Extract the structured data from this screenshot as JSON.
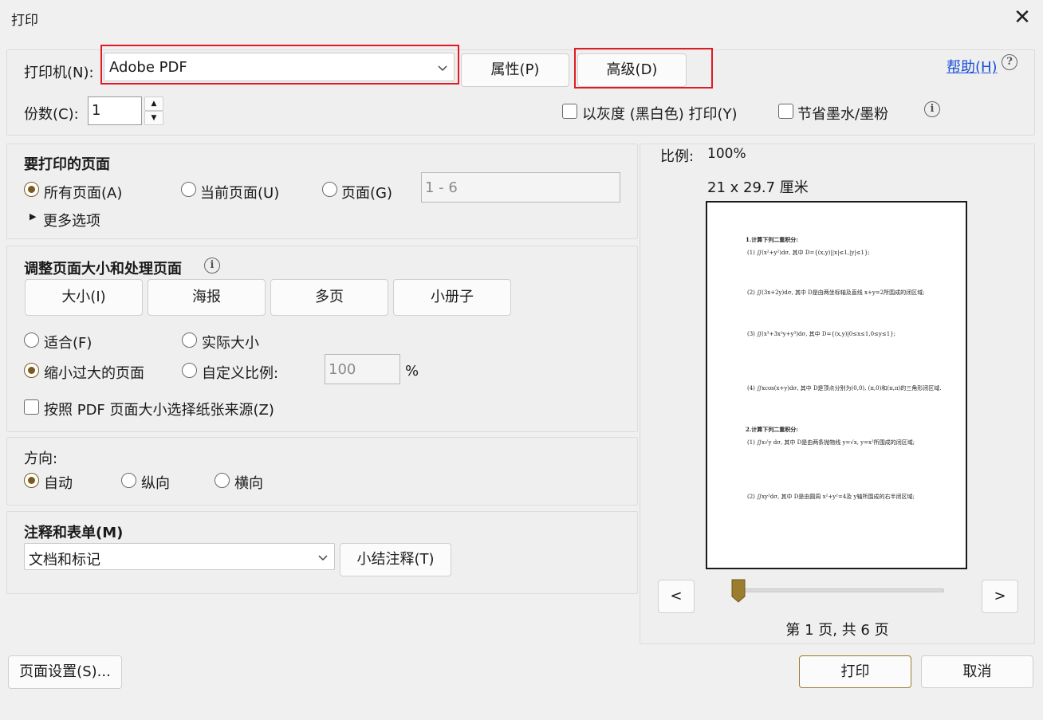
{
  "window": {
    "title": "打印",
    "close_icon": "close-icon"
  },
  "printer": {
    "label": "打印机(N):",
    "selected": "Adobe PDF",
    "properties_label": "属性(P)",
    "advanced_label": "高级(D)",
    "help_label": "帮助(H)"
  },
  "copies": {
    "label": "份数(C):",
    "value": "1"
  },
  "options": {
    "grayscale_label": "以灰度 (黑白色) 打印(Y)",
    "save_ink_label": "节省墨水/墨粉"
  },
  "pages_to_print": {
    "heading": "要打印的页面",
    "all_label": "所有页面(A)",
    "current_label": "当前页面(U)",
    "pages_label": "页面(G)",
    "range_placeholder": "1 - 6",
    "more_options": "更多选项"
  },
  "sizing": {
    "heading": "调整页面大小和处理页面",
    "tabs": [
      "大小(I)",
      "海报",
      "多页",
      "小册子"
    ],
    "fit_label": "适合(F)",
    "actual_label": "实际大小",
    "shrink_label": "缩小过大的页面",
    "custom_label": "自定义比例:",
    "custom_value": "100",
    "percent": "%",
    "paper_source_label": "按照 PDF 页面大小选择纸张来源(Z)"
  },
  "orientation": {
    "heading": "方向:",
    "auto_label": "自动",
    "portrait_label": "纵向",
    "landscape_label": "横向"
  },
  "comments": {
    "heading": "注释和表单(M)",
    "selected": "文档和标记",
    "summarize_label": "小结注释(T)"
  },
  "preview": {
    "scale_label": "比例:",
    "scale_value": "100%",
    "dimensions": "21 x 29.7 厘米",
    "prev": "<",
    "next": ">",
    "page_info": "第 1 页, 共 6 页",
    "slider_fraction": 0,
    "lines": [
      "1.计算下列二重积分:",
      "(1) ∬(x²+y²)dσ, 其中 D={(x,y)||x|≤1,|y|≤1};",
      "(2) ∬(3x+2y)dσ, 其中 D是由两坐标轴及直线 x+y=2所围成的闭区域;",
      "(3) ∬(x³+3x²y+y³)dσ, 其中 D={(x,y)|0≤x≤1,0≤y≤1};",
      "(4) ∬xcos(x+y)dσ, 其中 D是顶点分别为(0,0), (π,0)和(π,π)的三角形闭区域.",
      "2.计算下列二重积分:",
      "(1) ∬x√y dσ, 其中 D是由两条抛物线 y=√x, y=x²所围成的闭区域;",
      "(2) ∬xy²dσ, 其中 D是由圆周 x²+y²=4及 y轴所围成的右半闭区域;"
    ]
  },
  "footer": {
    "page_setup_label": "页面设置(S)...",
    "print_label": "打印",
    "cancel_label": "取消"
  },
  "colors": {
    "accent": "#7a5a1d",
    "highlight": "#e21a23",
    "link": "#1a4fd6"
  }
}
